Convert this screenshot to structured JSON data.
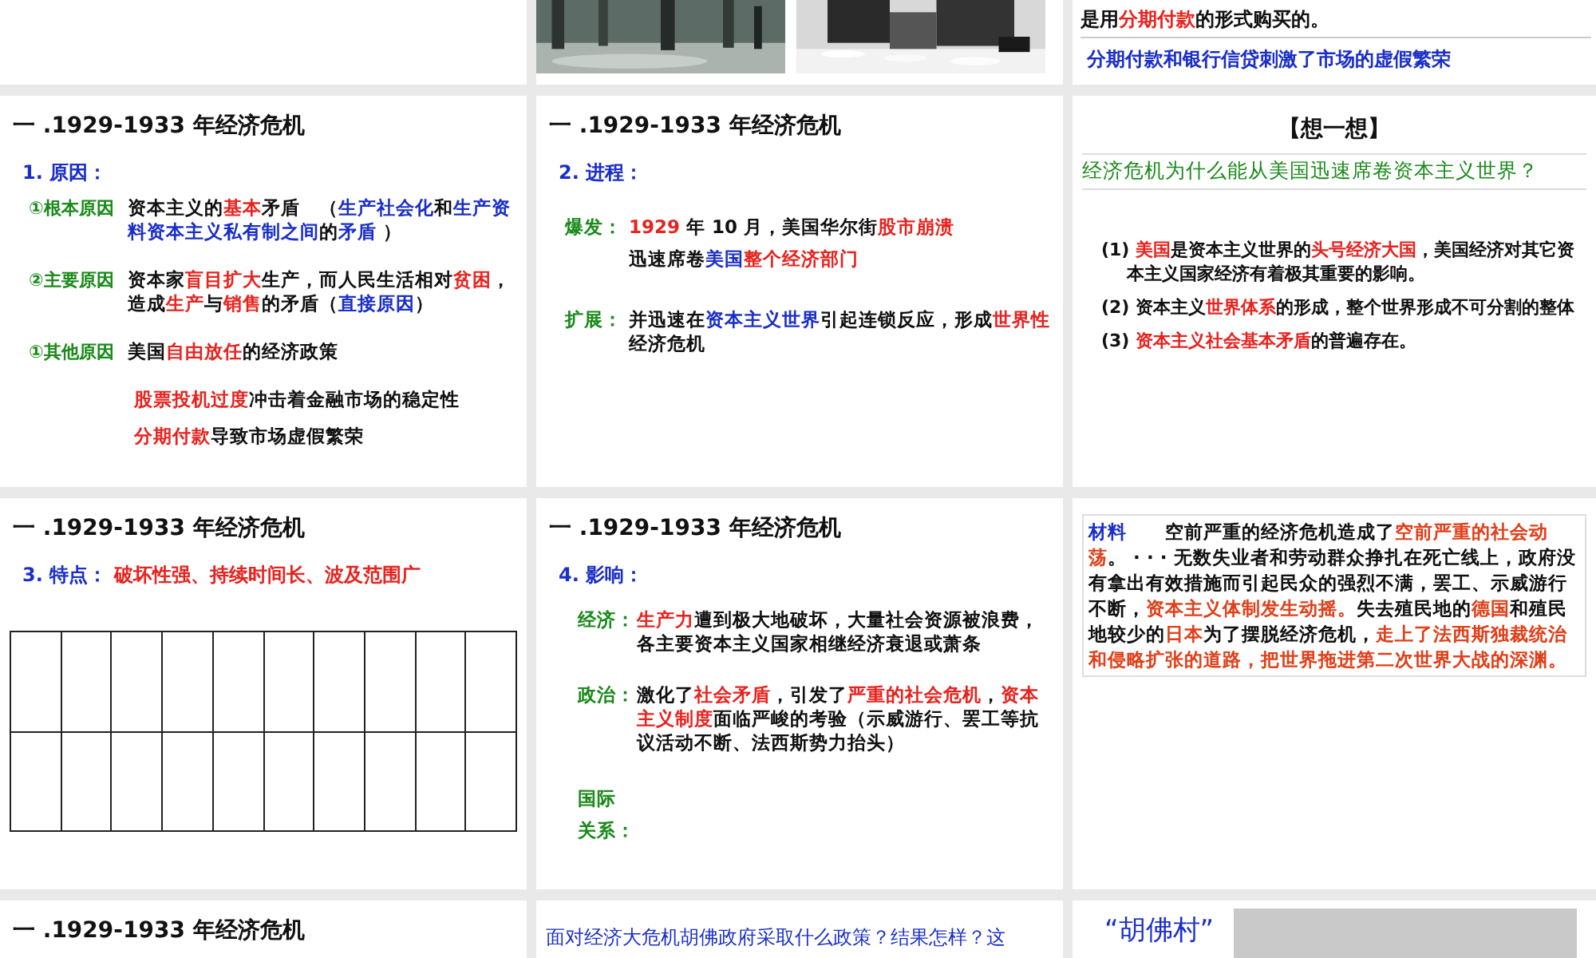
{
  "slides": [
    {
      "kind": "blank"
    },
    {
      "kind": "photos",
      "blocks": [
        {
          "kind": "picture"
        },
        {
          "kind": "picture"
        }
      ]
    },
    {
      "kind": "note",
      "blocks": [
        {
          "kind": "boxed",
          "runs": [
            {
              "text": "是用"
            },
            {
              "text": "分期付款",
              "color": "#e8231f"
            },
            {
              "text": "的形式购买的。"
            }
          ]
        },
        {
          "kind": "para",
          "runs": [
            {
              "text": "分期付款和银行信贷刺激了市场的虚假繁荣",
              "color": "#1b2fc8"
            }
          ]
        }
      ]
    },
    {
      "kind": "causes",
      "blocks": [
        {
          "kind": "title",
          "runs": [
            {
              "text": "一 .1929-1933 年经济危机"
            }
          ]
        },
        {
          "kind": "heading",
          "runs": [
            {
              "text": "1. 原因：",
              "color": "#1b2fc8"
            }
          ]
        },
        {
          "kind": "row",
          "label": "①根本原因",
          "lines": [
            [
              {
                "text": "资本主义的"
              },
              {
                "text": "基本",
                "color": "#e8231f"
              },
              {
                "text": "矛盾　（"
              },
              {
                "text": "生产社会化",
                "color": "#1b2fc8"
              },
              {
                "text": "和"
              },
              {
                "text": "生产资料资本主义私有制之间",
                "color": "#1b2fc8"
              },
              {
                "text": "的"
              },
              {
                "text": "矛盾",
                "color": "#1b2fc8"
              },
              {
                "text": " ）"
              }
            ]
          ]
        },
        {
          "kind": "row",
          "label": "②主要原因",
          "lines": [
            [
              {
                "text": "资本家"
              },
              {
                "text": "盲目扩大",
                "color": "#e8231f"
              },
              {
                "text": "生产，而人民生活相对"
              },
              {
                "text": "贫困",
                "color": "#e8231f"
              },
              {
                "text": "，造成"
              },
              {
                "text": "生产",
                "color": "#e8231f"
              },
              {
                "text": "与"
              },
              {
                "text": "销售",
                "color": "#e8231f"
              },
              {
                "text": "的矛盾（"
              },
              {
                "text": "直接原因",
                "color": "#1b2fc8"
              },
              {
                "text": "）"
              }
            ]
          ]
        },
        {
          "kind": "row",
          "label": "①其他原因",
          "lines": [
            [
              {
                "text": "美国"
              },
              {
                "text": "自由放任",
                "color": "#e8231f"
              },
              {
                "text": "的经济政策"
              }
            ]
          ]
        },
        {
          "kind": "para",
          "runs": [
            {
              "text": "股票投机过度",
              "color": "#e8231f"
            },
            {
              "text": "冲击着金融市场的稳定性"
            }
          ]
        },
        {
          "kind": "para",
          "runs": [
            {
              "text": "分期付款",
              "color": "#e8231f"
            },
            {
              "text": "导致市场虚假繁荣"
            }
          ]
        }
      ]
    },
    {
      "kind": "process",
      "blocks": [
        {
          "kind": "title",
          "runs": [
            {
              "text": "一 .1929-1933 年经济危机"
            }
          ]
        },
        {
          "kind": "heading",
          "runs": [
            {
              "text": "2. 进程：",
              "color": "#1b2fc8"
            }
          ]
        },
        {
          "kind": "row",
          "label": "爆发：",
          "lines": [
            [
              {
                "text": "1929",
                "color": "#e8231f"
              },
              {
                "text": " 年 10 月，美国华尔街"
              },
              {
                "text": "股市崩溃",
                "color": "#e8231f"
              }
            ],
            [
              {
                "text": "迅速席卷"
              },
              {
                "text": "美国",
                "color": "#1b2fc8"
              },
              {
                "text": "整个经济部门",
                "color": "#e8231f"
              }
            ]
          ]
        },
        {
          "kind": "row",
          "label": "扩展：",
          "lines": [
            [
              {
                "text": "并迅速在"
              },
              {
                "text": "资本主义世界",
                "color": "#1b2fc8"
              },
              {
                "text": "引起连锁反应，形成"
              },
              {
                "text": "世界性",
                "color": "#e8231f"
              },
              {
                "text": "经济危机"
              }
            ]
          ]
        }
      ]
    },
    {
      "kind": "think",
      "blocks": [
        {
          "kind": "think-title",
          "runs": [
            {
              "text": "【想一想】"
            }
          ]
        },
        {
          "kind": "question",
          "runs": [
            {
              "text": "经济危机为什么能从美国迅速席卷资本主义世界？",
              "color": "#1a8a1a"
            }
          ]
        },
        {
          "kind": "item",
          "runs": [
            {
              "text": "(1) "
            },
            {
              "text": "美国",
              "color": "#e8231f"
            },
            {
              "text": "是资本主义世界的"
            },
            {
              "text": "头号经济大国",
              "color": "#e8231f"
            },
            {
              "text": "，美国经济对其它资本主义国家经济有着极其重要的影响。"
            }
          ]
        },
        {
          "kind": "item",
          "runs": [
            {
              "text": "(2) 资本主义"
            },
            {
              "text": "世界体系",
              "color": "#e8231f"
            },
            {
              "text": "的形成，整个世界形成不可分割的整体"
            }
          ]
        },
        {
          "kind": "item",
          "runs": [
            {
              "text": "(3) "
            },
            {
              "text": "资本主义社会基本矛盾",
              "color": "#e8231f"
            },
            {
              "text": "的普遍存在。"
            }
          ]
        }
      ]
    },
    {
      "kind": "features",
      "blocks": [
        {
          "kind": "title",
          "runs": [
            {
              "text": "一 .1929-1933 年经济危机"
            }
          ]
        },
        {
          "kind": "heading",
          "runs": [
            {
              "text": "3. 特点：",
              "color": "#1b2fc8"
            },
            {
              "text": "  破坏性强、持续时间长、波及范围广",
              "color": "#e8231f"
            }
          ]
        },
        {
          "kind": "table",
          "rows": [
            {
              "cells": [
                {
                  "kind": "blank"
                },
                {
                  "kind": "blank"
                },
                {
                  "kind": "blank"
                },
                {
                  "kind": "blank"
                },
                {
                  "kind": "blank"
                },
                {
                  "kind": "blank"
                },
                {
                  "kind": "blank"
                },
                {
                  "kind": "blank"
                },
                {
                  "kind": "blank"
                },
                {
                  "kind": "blank"
                }
              ]
            },
            {
              "cells": [
                {
                  "kind": "blank"
                },
                {
                  "kind": "blank"
                },
                {
                  "kind": "blank"
                },
                {
                  "kind": "blank"
                },
                {
                  "kind": "blank"
                },
                {
                  "kind": "blank"
                },
                {
                  "kind": "blank"
                },
                {
                  "kind": "blank"
                },
                {
                  "kind": "blank"
                },
                {
                  "kind": "blank"
                }
              ]
            }
          ]
        }
      ]
    },
    {
      "kind": "impact",
      "blocks": [
        {
          "kind": "title",
          "runs": [
            {
              "text": "一 .1929-1933 年经济危机"
            }
          ]
        },
        {
          "kind": "heading",
          "runs": [
            {
              "text": "4. 影响：",
              "color": "#1b2fc8"
            }
          ]
        },
        {
          "kind": "row",
          "label": "经济：",
          "lines": [
            [
              {
                "text": "生产力",
                "color": "#e8231f"
              },
              {
                "text": "遭到极大地破坏，大量社会资源被浪费，各主要资本主义国家相继经济衰退或萧条"
              }
            ]
          ]
        },
        {
          "kind": "row",
          "label": "政治：",
          "lines": [
            [
              {
                "text": "激化了"
              },
              {
                "text": "社会矛盾",
                "color": "#e8231f"
              },
              {
                "text": "，引发了"
              },
              {
                "text": "严重的社会危机",
                "color": "#e8231f"
              },
              {
                "text": "，"
              },
              {
                "text": "资本主义制度",
                "color": "#e8231f"
              },
              {
                "text": "面临严峻的考验（示威游行、罢工等抗议活动不断、法西斯势力抬头）"
              }
            ]
          ]
        },
        {
          "kind": "row",
          "label_lines": [
            "国际",
            "关系："
          ]
        }
      ]
    },
    {
      "kind": "material",
      "blocks": [
        {
          "kind": "material",
          "runs": [
            {
              "text": "材料",
              "color": "#1b2fc8"
            },
            {
              "text": "　　空前严重的经济危机造成了"
            },
            {
              "text": "空前严重的社会动荡",
              "color": "#e0401a"
            },
            {
              "text": "。 · · · 无数失业者和劳动群众挣扎在死亡线上，政府没有拿出有效措施而引起民众的强烈不满，罢工、示威游行不断，"
            },
            {
              "text": "资本主义体制发生动摇。",
              "color": "#e0401a"
            },
            {
              "text": "失去殖民地的"
            },
            {
              "text": "德国",
              "color": "#e0401a"
            },
            {
              "text": "和殖民地较少的"
            },
            {
              "text": "日本",
              "color": "#e0401a"
            },
            {
              "text": "为了摆脱经济危机，"
            },
            {
              "text": "走上了法西斯独裁统治和侵略扩张的道路，把世界拖进第二次世界大战的深渊。",
              "color": "#e0401a"
            }
          ]
        }
      ]
    },
    {
      "kind": "titled",
      "blocks": [
        {
          "kind": "title",
          "runs": [
            {
              "text": "一 .1929-1933 年经济危机"
            }
          ]
        }
      ]
    },
    {
      "kind": "question",
      "blocks": [
        {
          "kind": "para",
          "runs": [
            {
              "text": "面对经济大危机胡佛政府采取什么政策？结果怎样？这",
              "color": "#1b2fc8"
            }
          ]
        }
      ]
    },
    {
      "kind": "hooverville",
      "blocks": [
        {
          "kind": "caption",
          "runs": [
            {
              "text": "“胡佛村”",
              "color": "#1b2fc8"
            }
          ]
        },
        {
          "kind": "picture"
        }
      ]
    }
  ]
}
